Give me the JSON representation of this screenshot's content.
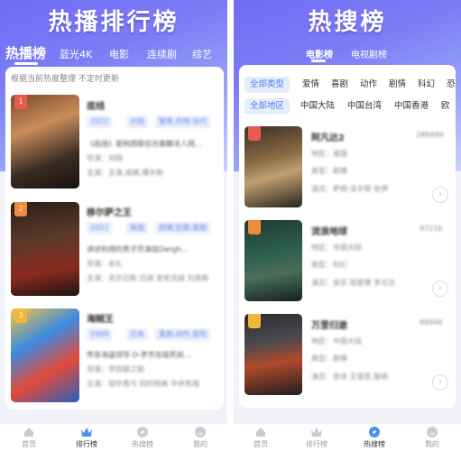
{
  "left": {
    "title": "热播排行榜",
    "tabs": [
      "热播榜",
      "蓝光4K",
      "电影",
      "连续剧",
      "综艺"
    ],
    "notice": "根据当前热度整理 不定时更新",
    "items": [
      {
        "rank": "1",
        "title": "底线",
        "tags": [
          "2022",
          "大陆",
          "警匪,内地,当代"
        ],
        "desc": "《底线》是韩国版综合案籍法人网...",
        "line2": "导演：刘国",
        "line3": "主演：主演,成楠,爆天粉"
      },
      {
        "rank": "2",
        "title": "移尔萨之王",
        "tags": [
          "2022",
          "美国",
          "剧情,犯罪,喜剧"
        ],
        "desc": "讲述利用的男子凭演技Dwigh...",
        "line2": "导演：米扎",
        "line3": "主演：克尔迈斯·迈迪 史密克娃 刘易斯"
      },
      {
        "rank": "3",
        "title": "海贼王",
        "tags": [
          "1999",
          "日本",
          "喜剧,动作,冒险"
        ],
        "desc": "传奇海盗领导-D-罗杰在临死前...",
        "line2": "导演：宇田钢之助",
        "line3": "主演：田中真弓 冈村明美 中井和哉"
      }
    ]
  },
  "right": {
    "title": "热搜榜",
    "tabs": [
      "电影榜",
      "电视剧榜"
    ],
    "filters_type": [
      "全部类型",
      "爱情",
      "喜剧",
      "动作",
      "剧情",
      "科幻",
      "恐"
    ],
    "filters_region": [
      "全部地区",
      "中国大陆",
      "中国台湾",
      "中国香港",
      "欧"
    ],
    "items": [
      {
        "title": "阿凡达2",
        "score": "288489",
        "line1": "地区：美国",
        "line2": "类型：剧情",
        "line3": "演员：萨姆·沃辛顿 佐伊"
      },
      {
        "title": "流浪地球",
        "score": "97216",
        "line1": "地区：中国大陆",
        "line2": "类型：科幻",
        "line3": "演员：吴京 屈楚萧 李光洁"
      },
      {
        "title": "万里归途",
        "score": "89946",
        "line1": "地区：中国大陆",
        "line2": "类型：剧情",
        "line3": "演员：张译 王俊凯 殷桃"
      }
    ]
  },
  "nav": [
    "首页",
    "排行榜",
    "热搜榜",
    "我的"
  ],
  "colors": {
    "accent": "#6f6cf4",
    "tag_text": "#6c89e8",
    "tag_bg": "#e8eefc",
    "chip_active": "#4a7df0"
  }
}
